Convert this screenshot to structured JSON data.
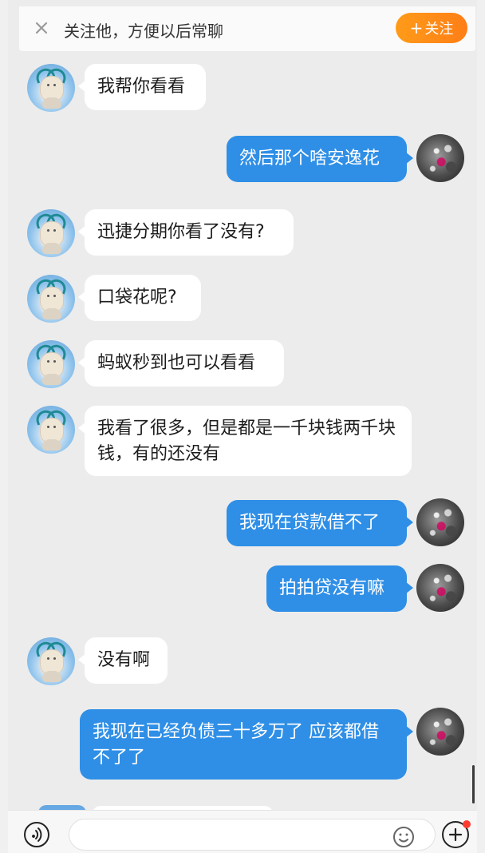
{
  "header": {
    "close_icon": "close-icon",
    "follow_tip": "关注他，方便以后常聊",
    "follow_button_plus": "+",
    "follow_button_label": "关注"
  },
  "messages": [
    {
      "sender": "other",
      "text": "我帮你看看"
    },
    {
      "sender": "me",
      "text": "然后那个啥安逸花"
    },
    {
      "sender": "other",
      "text": "迅捷分期你看了没有?"
    },
    {
      "sender": "other",
      "text": "口袋花呢?"
    },
    {
      "sender": "other",
      "text": "蚂蚁秒到也可以看看"
    },
    {
      "sender": "other",
      "text": "我看了很多，但是都是一千块钱两千块钱，有的还没有"
    },
    {
      "sender": "me",
      "text": "我现在贷款借不了"
    },
    {
      "sender": "me",
      "text": "拍拍贷没有嘛"
    },
    {
      "sender": "other",
      "text": "没有啊"
    },
    {
      "sender": "me",
      "text": "我现在已经负债三十多万了 应该都借不了了"
    }
  ],
  "composer": {
    "voice_icon": "voice-icon",
    "input_placeholder": "",
    "emoji_icon": "emoji-icon",
    "plus_icon": "plus-icon"
  },
  "colors": {
    "accent": "#2f8fe6",
    "follow": "#ff8a18",
    "badge": "#ff3b30"
  }
}
